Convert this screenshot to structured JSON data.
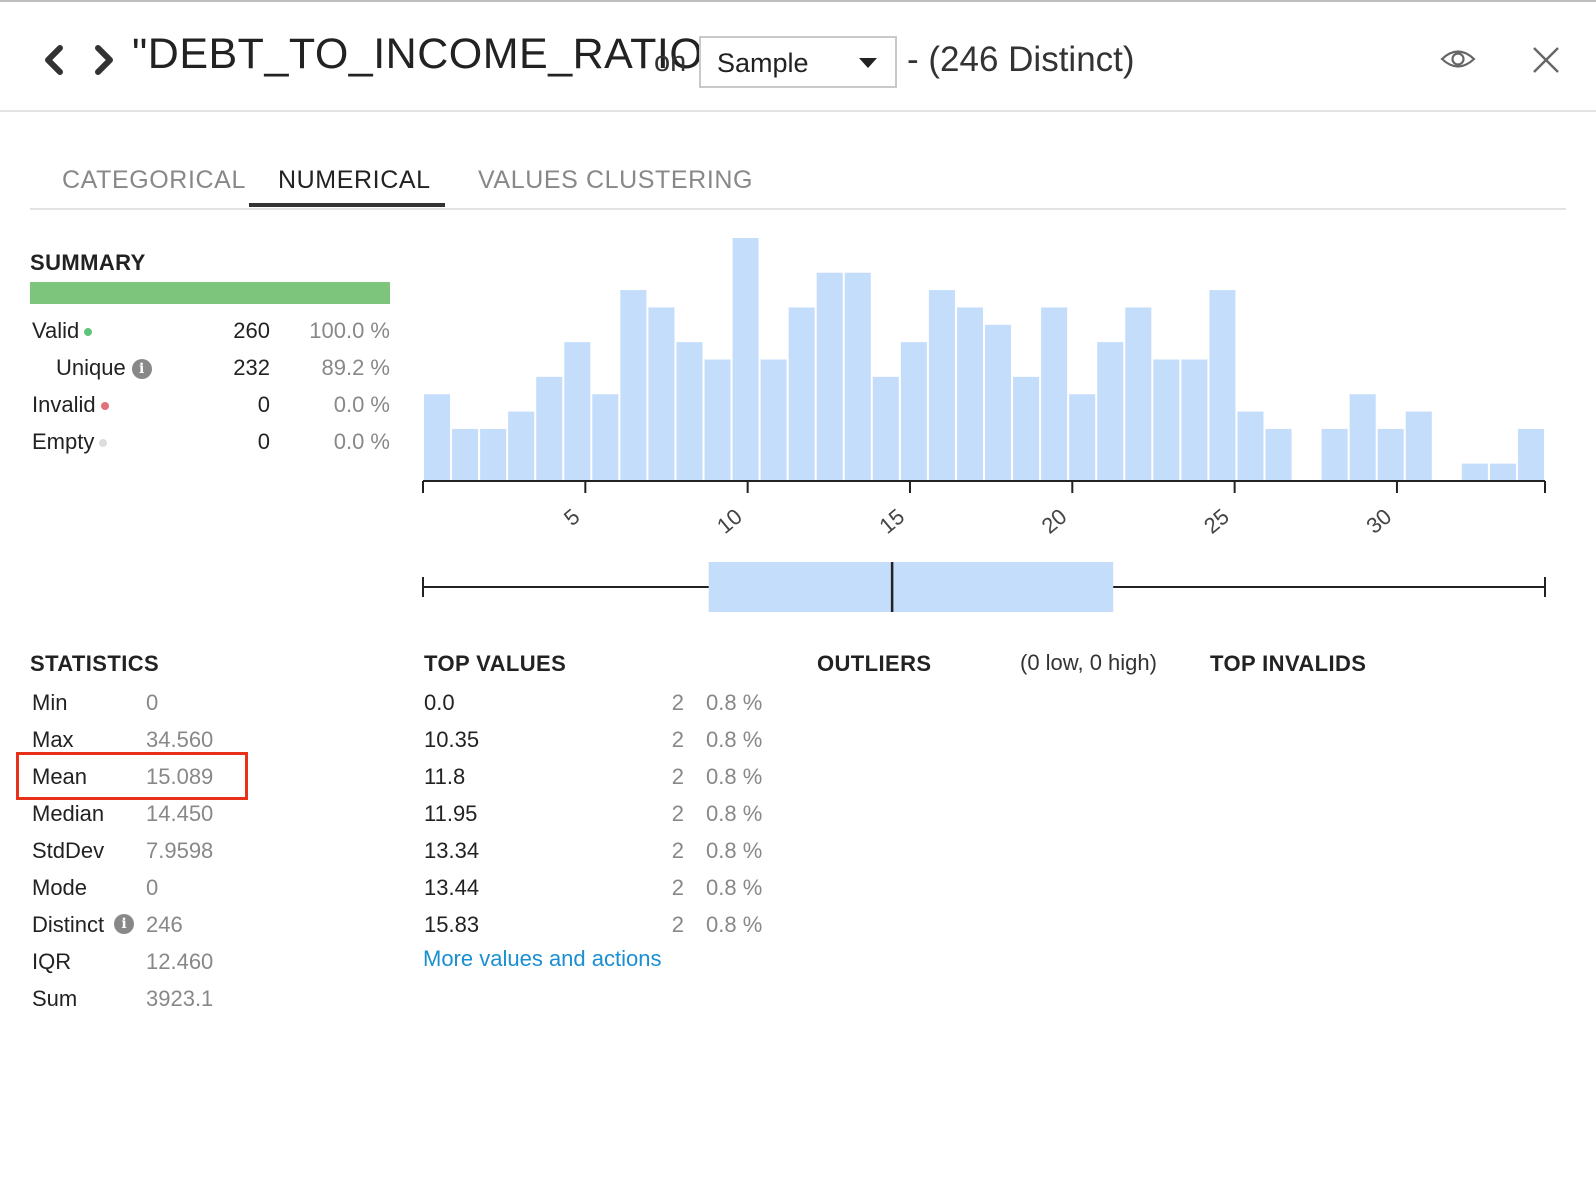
{
  "header": {
    "title": "\"DEBT_TO_INCOME_RATIO\"",
    "on_label": "on",
    "sample_select": "Sample",
    "distinct_label": "- (246 Distinct)"
  },
  "tabs": [
    {
      "label": "CATEGORICAL"
    },
    {
      "label": "NUMERICAL"
    },
    {
      "label": "VALUES CLUSTERING"
    }
  ],
  "summary": {
    "title": "SUMMARY",
    "rows": [
      {
        "label": "Valid",
        "count": "260",
        "percent": "100.0 %",
        "dot_color": "#5fc47a"
      },
      {
        "label": "Unique",
        "count": "232",
        "percent": "89.2 %"
      },
      {
        "label": "Invalid",
        "count": "0",
        "percent": "0.0 %",
        "dot_color": "#e0737a"
      },
      {
        "label": "Empty",
        "count": "0",
        "percent": "0.0 %",
        "dot_color": "#dddddd"
      }
    ]
  },
  "chart_data": [
    {
      "type": "bar",
      "title": "",
      "x_range": [
        0,
        34.56
      ],
      "xticks": [
        "5",
        "10",
        "15",
        "20",
        "25",
        "30"
      ],
      "xtick_values": [
        5,
        10,
        15,
        20,
        25,
        30
      ],
      "bin_counts": [
        5,
        3,
        3,
        4,
        6,
        8,
        5,
        11,
        10,
        8,
        7,
        14,
        7,
        10,
        12,
        12,
        6,
        8,
        11,
        10,
        9,
        6,
        10,
        5,
        8,
        10,
        7,
        7,
        11,
        4,
        3,
        0,
        3,
        5,
        3,
        4,
        0,
        1,
        1,
        3
      ],
      "ylim": [
        0,
        14
      ],
      "color": "#c4ddfb"
    },
    {
      "type": "boxplot",
      "min": 0,
      "q1": 8.8,
      "median": 14.45,
      "q3": 21.26,
      "max": 34.56,
      "color": "#c4ddfb"
    }
  ],
  "statistics": {
    "title": "STATISTICS",
    "rows": [
      {
        "label": "Min",
        "value": "0"
      },
      {
        "label": "Max",
        "value": "34.560"
      },
      {
        "label": "Mean",
        "value": "15.089"
      },
      {
        "label": "Median",
        "value": "14.450"
      },
      {
        "label": "StdDev",
        "value": "7.9598"
      },
      {
        "label": "Mode",
        "value": "0"
      },
      {
        "label": "Distinct",
        "value": "246"
      },
      {
        "label": "IQR",
        "value": "12.460"
      },
      {
        "label": "Sum",
        "value": "3923.1"
      }
    ],
    "highlight_color": "#e8311a"
  },
  "top_values": {
    "title": "TOP VALUES",
    "rows": [
      {
        "value": "0.0",
        "count": "2",
        "percent": "0.8 %"
      },
      {
        "value": "10.35",
        "count": "2",
        "percent": "0.8 %"
      },
      {
        "value": "11.8",
        "count": "2",
        "percent": "0.8 %"
      },
      {
        "value": "11.95",
        "count": "2",
        "percent": "0.8 %"
      },
      {
        "value": "13.34",
        "count": "2",
        "percent": "0.8 %"
      },
      {
        "value": "13.44",
        "count": "2",
        "percent": "0.8 %"
      },
      {
        "value": "15.83",
        "count": "2",
        "percent": "0.8 %"
      }
    ],
    "more_link": "More values and actions"
  },
  "outliers": {
    "title": "OUTLIERS",
    "subtitle": "(0 low, 0 high)"
  },
  "top_invalids": {
    "title": "TOP INVALIDS"
  },
  "icons": {
    "back": "chevron-left-icon",
    "forward": "chevron-right-icon",
    "eye": "eye-icon",
    "close": "close-icon",
    "info": "info-icon"
  }
}
